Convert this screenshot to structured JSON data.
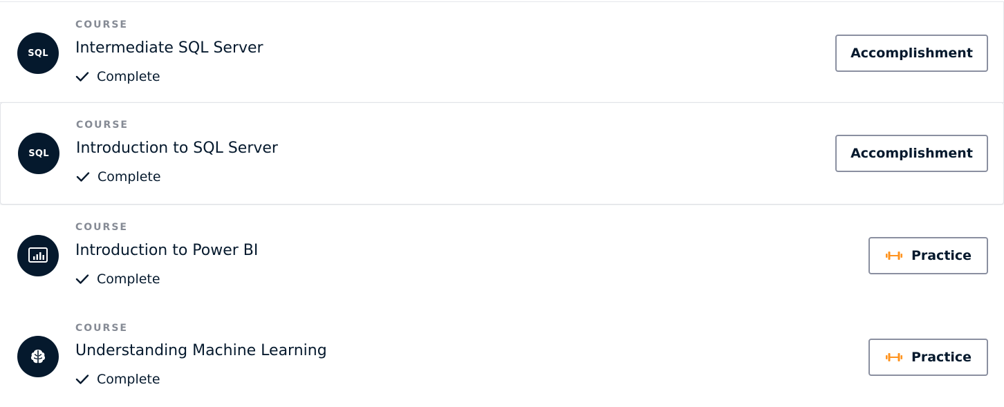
{
  "courses": [
    {
      "kind": "COURSE",
      "title": "Intermediate SQL Server",
      "avatar_text": "SQL",
      "icon": "sql-badge",
      "status": "Complete",
      "action_label": "Accomplishment",
      "action_icon": null
    },
    {
      "kind": "COURSE",
      "title": "Introduction to SQL Server",
      "avatar_text": "SQL",
      "icon": "sql-badge",
      "status": "Complete",
      "action_label": "Accomplishment",
      "action_icon": null
    },
    {
      "kind": "COURSE",
      "title": "Introduction to Power BI",
      "avatar_text": "",
      "icon": "bar-chart-icon",
      "status": "Complete",
      "action_label": "Practice",
      "action_icon": "dumbbell-icon"
    },
    {
      "kind": "COURSE",
      "title": "Understanding Machine Learning",
      "avatar_text": "",
      "icon": "brain-icon",
      "status": "Complete",
      "action_label": "Practice",
      "action_icon": "dumbbell-icon"
    }
  ],
  "colors": {
    "navy": "#05192d",
    "muted": "#868b95",
    "button_border": "#8a8fa0",
    "practice_accent": "#ff931e"
  }
}
